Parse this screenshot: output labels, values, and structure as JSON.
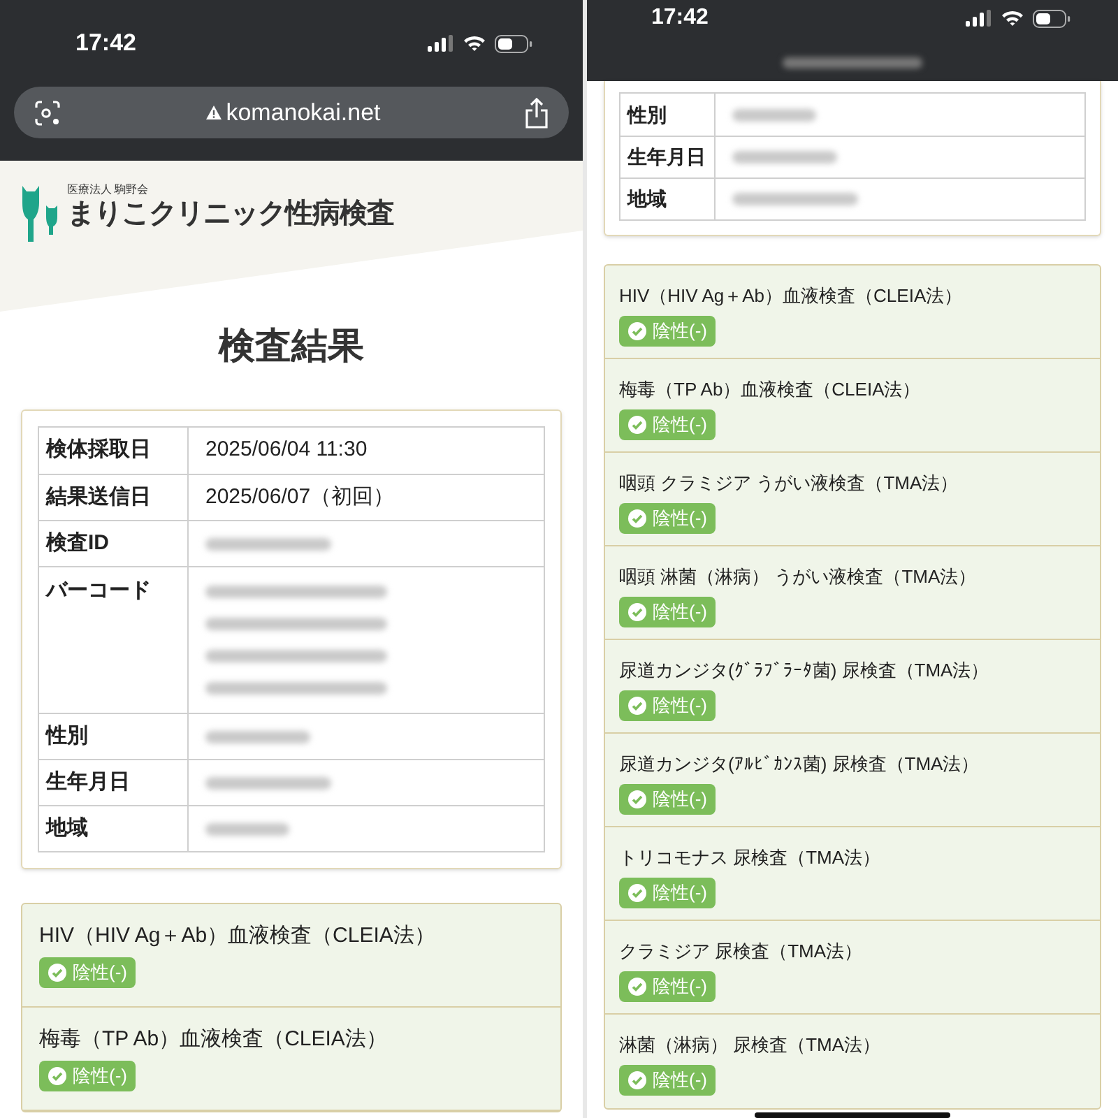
{
  "left_screen": {
    "status_bar": {
      "time": "17:42"
    },
    "url_bar": {
      "url": "komanokai.net"
    },
    "logo": {
      "subtitle": "医療法人 駒野会",
      "title": "まりこクリニック性病検査"
    },
    "page_title": "検査結果",
    "info_rows": [
      {
        "label": "検体採取日",
        "value": "2025/06/04  11:30",
        "kind": "single"
      },
      {
        "label": "結果送信日",
        "value": "2025/06/07（初回）",
        "kind": "single"
      },
      {
        "label": "検査ID",
        "kind": "single"
      },
      {
        "label": "バーコード",
        "kind": "multi"
      },
      {
        "label": "性別",
        "kind": "single"
      },
      {
        "label": "生年月日",
        "kind": "single"
      },
      {
        "label": "地域",
        "kind": "single"
      }
    ],
    "results": [
      {
        "name": "HIV（HIV Ag＋Ab）血液検査（CLEIA法）",
        "result": "陰性(-)",
        "negative": true
      },
      {
        "name": "梅毒（TP Ab）血液検査（CLEIA法）",
        "result": "陰性(-)",
        "negative": true
      }
    ]
  },
  "right_screen": {
    "status_bar": {
      "time": "17:42"
    },
    "info_rows": [
      {
        "label": "性別"
      },
      {
        "label": "生年月日"
      },
      {
        "label": "地域"
      }
    ],
    "results": [
      {
        "name": "HIV（HIV Ag＋Ab）血液検査（CLEIA法）",
        "result": "陰性(-)",
        "negative": true
      },
      {
        "name": "梅毒（TP Ab）血液検査（CLEIA法）",
        "result": "陰性(-)",
        "negative": true
      },
      {
        "name": "咽頭 クラミジア うがい液検査（TMA法）",
        "result": "陰性(-)",
        "negative": true
      },
      {
        "name": "咽頭 淋菌（淋病） うがい液検査（TMA法）",
        "result": "陰性(-)",
        "negative": true
      },
      {
        "name": "尿道カンジタ(ｸﾞﾗﾌﾞﾗｰﾀ菌) 尿検査（TMA法）",
        "result": "陰性(-)",
        "negative": true
      },
      {
        "name": "尿道カンジタ(ｱﾙﾋﾞｶﾝｽ菌) 尿検査（TMA法）",
        "result": "陰性(-)",
        "negative": true
      },
      {
        "name": "トリコモナス 尿検査（TMA法）",
        "result": "陰性(-)",
        "negative": true
      },
      {
        "name": "クラミジア 尿検査（TMA法）",
        "result": "陰性(-)",
        "negative": true
      },
      {
        "name": "淋菌（淋病） 尿検査（TMA法）",
        "result": "陰性(-)",
        "negative": true
      }
    ]
  }
}
